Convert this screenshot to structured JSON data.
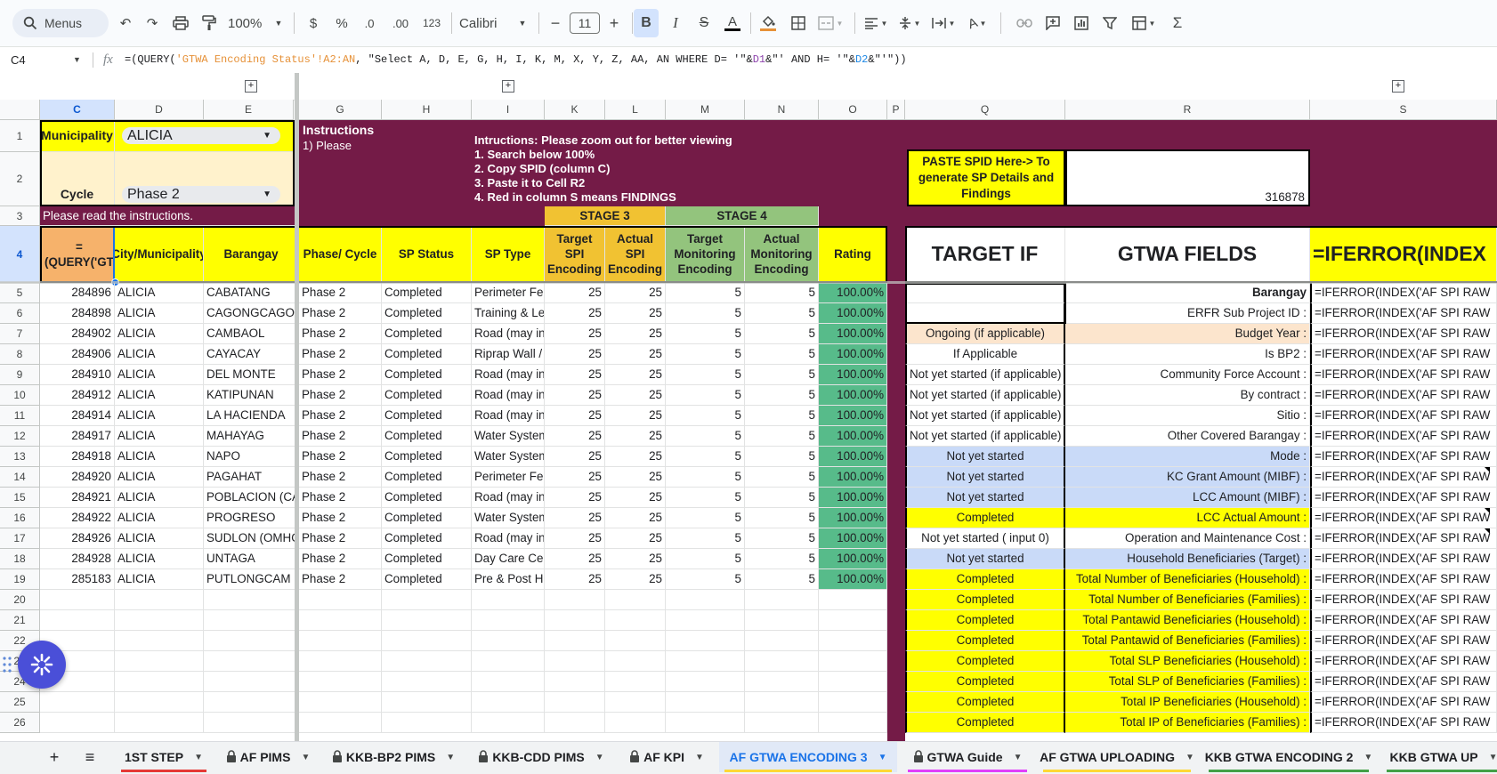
{
  "toolbar": {
    "menus_label": "Menus",
    "zoom": "100%",
    "currency": "$",
    "percent": "%",
    "dec_decrease": ".0",
    "dec_increase": ".00",
    "number_format": "123",
    "font": "Calibri",
    "font_size": "11"
  },
  "formula_bar": {
    "cell_ref": "C4",
    "fx": "fx",
    "formula_prefix": "=(QUERY(",
    "formula_ref1": "'GTWA Encoding Status'!A2:AN",
    "formula_mid": ", \"Select A, D, E, G, H, I, K, M, X, Y, Z, AA, AN WHERE D= '\"&",
    "formula_ref2": "D1",
    "formula_mid2": "&\"' AND H= '\"&",
    "formula_ref3": "D2",
    "formula_end": "&\"'\"))"
  },
  "columns": [
    "C",
    "D",
    "E",
    "G",
    "H",
    "I",
    "K",
    "L",
    "M",
    "N",
    "O",
    "P",
    "Q",
    "R",
    "S"
  ],
  "row_numbers": [
    "1",
    "2",
    "3",
    "4",
    "5",
    "6",
    "7",
    "8",
    "9",
    "10",
    "11",
    "12",
    "13",
    "14",
    "15",
    "16",
    "17",
    "18",
    "19",
    "20",
    "21",
    "22",
    "23",
    "24",
    "25",
    "26"
  ],
  "header": {
    "municipality_label": "Municipality",
    "municipality_value": "ALICIA",
    "cycle_label": "Cycle",
    "cycle_value": "Phase 2",
    "read_instructions": "Please read the instructions.",
    "instructions_title": "Instructions",
    "instructions_clip": "1) Please",
    "instr_lines": [
      "Intructions: Please zoom out for better viewing",
      "1. Search below 100%",
      "2. Copy SPID (column C)",
      "3. Paste it to Cell R2",
      "4. Red in column S means FINDINGS"
    ],
    "at_sign": "@",
    "paste_spid": "PASTE SPID Here-> To generate SP Details and Findings",
    "spid_value": "316878",
    "stage3": "STAGE 3",
    "stage4": "STAGE 4"
  },
  "table_headers": {
    "c": "=(QUERY('GT",
    "d": "City/Municipality",
    "e": "Barangay",
    "g": "Phase/ Cycle",
    "h": "SP Status",
    "i": "SP Type",
    "k": "Target SPI Encoding",
    "l": "Actual SPI Encoding",
    "m": "Target Monitoring Encoding",
    "n": "Actual Monitoring Encoding",
    "o": "Rating",
    "q": "TARGET IF",
    "r": "GTWA FIELDS",
    "s": "=IFERROR(INDEX"
  },
  "rows": [
    {
      "spid": "284896",
      "city": "ALICIA",
      "brgy": "CABATANG",
      "phase": "Phase 2",
      "status": "Completed",
      "type": "Perimeter Fen",
      "k": "25",
      "l": "25",
      "m": "5",
      "n": "5",
      "rating": "100.00%"
    },
    {
      "spid": "284898",
      "city": "ALICIA",
      "brgy": "CAGONGCAGO",
      "phase": "Phase 2",
      "status": "Completed",
      "type": "Training & Le",
      "k": "25",
      "l": "25",
      "m": "5",
      "n": "5",
      "rating": "100.00%"
    },
    {
      "spid": "284902",
      "city": "ALICIA",
      "brgy": "CAMBAOL",
      "phase": "Phase 2",
      "status": "Completed",
      "type": "Road (may in",
      "k": "25",
      "l": "25",
      "m": "5",
      "n": "5",
      "rating": "100.00%"
    },
    {
      "spid": "284906",
      "city": "ALICIA",
      "brgy": "CAYACAY",
      "phase": "Phase 2",
      "status": "Completed",
      "type": "Riprap Wall /",
      "k": "25",
      "l": "25",
      "m": "5",
      "n": "5",
      "rating": "100.00%"
    },
    {
      "spid": "284910",
      "city": "ALICIA",
      "brgy": "DEL MONTE",
      "phase": "Phase 2",
      "status": "Completed",
      "type": "Road (may in",
      "k": "25",
      "l": "25",
      "m": "5",
      "n": "5",
      "rating": "100.00%"
    },
    {
      "spid": "284912",
      "city": "ALICIA",
      "brgy": "KATIPUNAN",
      "phase": "Phase 2",
      "status": "Completed",
      "type": "Road (may in",
      "k": "25",
      "l": "25",
      "m": "5",
      "n": "5",
      "rating": "100.00%"
    },
    {
      "spid": "284914",
      "city": "ALICIA",
      "brgy": "LA HACIENDA",
      "phase": "Phase 2",
      "status": "Completed",
      "type": "Road (may in",
      "k": "25",
      "l": "25",
      "m": "5",
      "n": "5",
      "rating": "100.00%"
    },
    {
      "spid": "284917",
      "city": "ALICIA",
      "brgy": "MAHAYAG",
      "phase": "Phase 2",
      "status": "Completed",
      "type": "Water System",
      "k": "25",
      "l": "25",
      "m": "5",
      "n": "5",
      "rating": "100.00%"
    },
    {
      "spid": "284918",
      "city": "ALICIA",
      "brgy": "NAPO",
      "phase": "Phase 2",
      "status": "Completed",
      "type": "Water System",
      "k": "25",
      "l": "25",
      "m": "5",
      "n": "5",
      "rating": "100.00%"
    },
    {
      "spid": "284920",
      "city": "ALICIA",
      "brgy": "PAGAHAT",
      "phase": "Phase 2",
      "status": "Completed",
      "type": "Perimeter Fen",
      "k": "25",
      "l": "25",
      "m": "5",
      "n": "5",
      "rating": "100.00%"
    },
    {
      "spid": "284921",
      "city": "ALICIA",
      "brgy": "POBLACION (CA",
      "phase": "Phase 2",
      "status": "Completed",
      "type": "Road (may in",
      "k": "25",
      "l": "25",
      "m": "5",
      "n": "5",
      "rating": "100.00%"
    },
    {
      "spid": "284922",
      "city": "ALICIA",
      "brgy": "PROGRESO",
      "phase": "Phase 2",
      "status": "Completed",
      "type": "Water System",
      "k": "25",
      "l": "25",
      "m": "5",
      "n": "5",
      "rating": "100.00%"
    },
    {
      "spid": "284926",
      "city": "ALICIA",
      "brgy": "SUDLON (OMHO",
      "phase": "Phase 2",
      "status": "Completed",
      "type": "Road (may in",
      "k": "25",
      "l": "25",
      "m": "5",
      "n": "5",
      "rating": "100.00%"
    },
    {
      "spid": "284928",
      "city": "ALICIA",
      "brgy": "UNTAGA",
      "phase": "Phase 2",
      "status": "Completed",
      "type": "Day Care Cen",
      "k": "25",
      "l": "25",
      "m": "5",
      "n": "5",
      "rating": "100.00%"
    },
    {
      "spid": "285183",
      "city": "ALICIA",
      "brgy": "PUTLONGCAM",
      "phase": "Phase 2",
      "status": "Completed",
      "type": "Pre & Post Ha",
      "k": "25",
      "l": "25",
      "m": "5",
      "n": "5",
      "rating": "100.00%"
    }
  ],
  "gtwa": [
    {
      "target": "",
      "bg": "#ffffff",
      "field": "Barangay",
      "bold": true,
      "s": "=IFERROR(INDEX('AF SPI RAW"
    },
    {
      "target": "",
      "bg": "#ffffff",
      "field": "ERFR Sub Project ID :",
      "s": "=IFERROR(INDEX('AF SPI RAW"
    },
    {
      "target": "Ongoing (if applicable)",
      "bg": "#fce5cd",
      "field": "Budget Year :",
      "s": "=IFERROR(INDEX('AF SPI RAW"
    },
    {
      "target": "If Applicable",
      "bg": "#ffffff",
      "field": "Is BP2 :",
      "s": "=IFERROR(INDEX('AF SPI RAW"
    },
    {
      "target": "Not yet started (if applicable)",
      "bg": "#ffffff",
      "field": "Community Force Account :",
      "s": "=IFERROR(INDEX('AF SPI RAW"
    },
    {
      "target": "Not yet started (if applicable)",
      "bg": "#ffffff",
      "field": "By contract :",
      "s": "=IFERROR(INDEX('AF SPI RAW"
    },
    {
      "target": "Not yet started (if applicable)",
      "bg": "#ffffff",
      "field": "Sitio :",
      "s": "=IFERROR(INDEX('AF SPI RAW"
    },
    {
      "target": "Not yet started (if applicable)",
      "bg": "#ffffff",
      "field": "Other Covered Barangay :",
      "s": "=IFERROR(INDEX('AF SPI RAW"
    },
    {
      "target": "Not yet started",
      "bg": "#c9daf8",
      "field": "Mode :",
      "s": "=IFERROR(INDEX('AF SPI RAW"
    },
    {
      "target": "Not yet started",
      "bg": "#c9daf8",
      "field": "KC Grant Amount (MIBF) :",
      "s": "=IFERROR(INDEX('AF SPI RAW"
    },
    {
      "target": "Not yet started",
      "bg": "#c9daf8",
      "field": "LCC Amount (MIBF) :",
      "s": "=IFERROR(INDEX('AF SPI RAW"
    },
    {
      "target": "Completed",
      "bg": "#ffff00",
      "field": "LCC Actual Amount :",
      "s": "=IFERROR(INDEX('AF SPI RAW"
    },
    {
      "target": "Not yet started ( input 0)",
      "bg": "#ffffff",
      "field": "Operation and Maintenance Cost :",
      "s": "=IFERROR(INDEX('AF SPI RAW"
    },
    {
      "target": "Not yet started",
      "bg": "#c9daf8",
      "field": "Household Beneficiaries (Target) :",
      "s": "=IFERROR(INDEX('AF SPI RAW"
    },
    {
      "target": "Completed",
      "bg": "#ffff00",
      "field": "Total Number of Beneficiaries (Household) :",
      "s": "=IFERROR(INDEX('AF SPI RAW"
    },
    {
      "target": "Completed",
      "bg": "#ffff00",
      "field": "Total Number of Beneficiaries (Families) :",
      "s": "=IFERROR(INDEX('AF SPI RAW"
    },
    {
      "target": "Completed",
      "bg": "#ffff00",
      "field": "Total Pantawid Beneficiaries (Household) :",
      "s": "=IFERROR(INDEX('AF SPI RAW"
    },
    {
      "target": "Completed",
      "bg": "#ffff00",
      "field": "Total Pantawid of Beneficiaries (Families) :",
      "s": "=IFERROR(INDEX('AF SPI RAW"
    },
    {
      "target": "Completed",
      "bg": "#ffff00",
      "field": "Total SLP Beneficiaries (Household) :",
      "s": "=IFERROR(INDEX('AF SPI RAW"
    },
    {
      "target": "Completed",
      "bg": "#ffff00",
      "field": "Total SLP of Beneficiaries (Families) :",
      "s": "=IFERROR(INDEX('AF SPI RAW"
    },
    {
      "target": "Completed",
      "bg": "#ffff00",
      "field": "Total IP Beneficiaries (Household) :",
      "s": "=IFERROR(INDEX('AF SPI RAW"
    },
    {
      "target": "Completed",
      "bg": "#ffff00",
      "field": "Total IP of Beneficiaries (Families) :",
      "s": "=IFERROR(INDEX('AF SPI RAW"
    }
  ],
  "tabs": [
    {
      "label": "+",
      "kind": "add"
    },
    {
      "label": "≡",
      "kind": "all"
    },
    {
      "label": "1ST STEP",
      "underline": "#e53935"
    },
    {
      "label": "AF PIMS",
      "lock": true
    },
    {
      "label": "KKB-BP2 PIMS",
      "lock": true
    },
    {
      "label": "KKB-CDD PIMS",
      "lock": true
    },
    {
      "label": "AF KPI",
      "lock": true
    },
    {
      "label": "AF GTWA ENCODING 3",
      "active": true,
      "underline": "#fdd835"
    },
    {
      "label": "GTWA Guide",
      "lock": true,
      "underline": "#e040fb"
    },
    {
      "label": "AF GTWA UPLOADING",
      "underline": "#fdd835"
    },
    {
      "label": "KKB GTWA ENCODING 2",
      "underline": "#43a047"
    },
    {
      "label": "KKB GTWA UP",
      "underline": "#43a047"
    }
  ],
  "colors": {
    "maroon": "#741b47",
    "yellow": "#ffff00",
    "stage3": "#f1c232",
    "stage4": "#93c47d",
    "rating_green": "#57bb8a",
    "cream": "#fff2cc",
    "select_orange": "#f6b26b",
    "active_tab": "#1a73e8"
  }
}
